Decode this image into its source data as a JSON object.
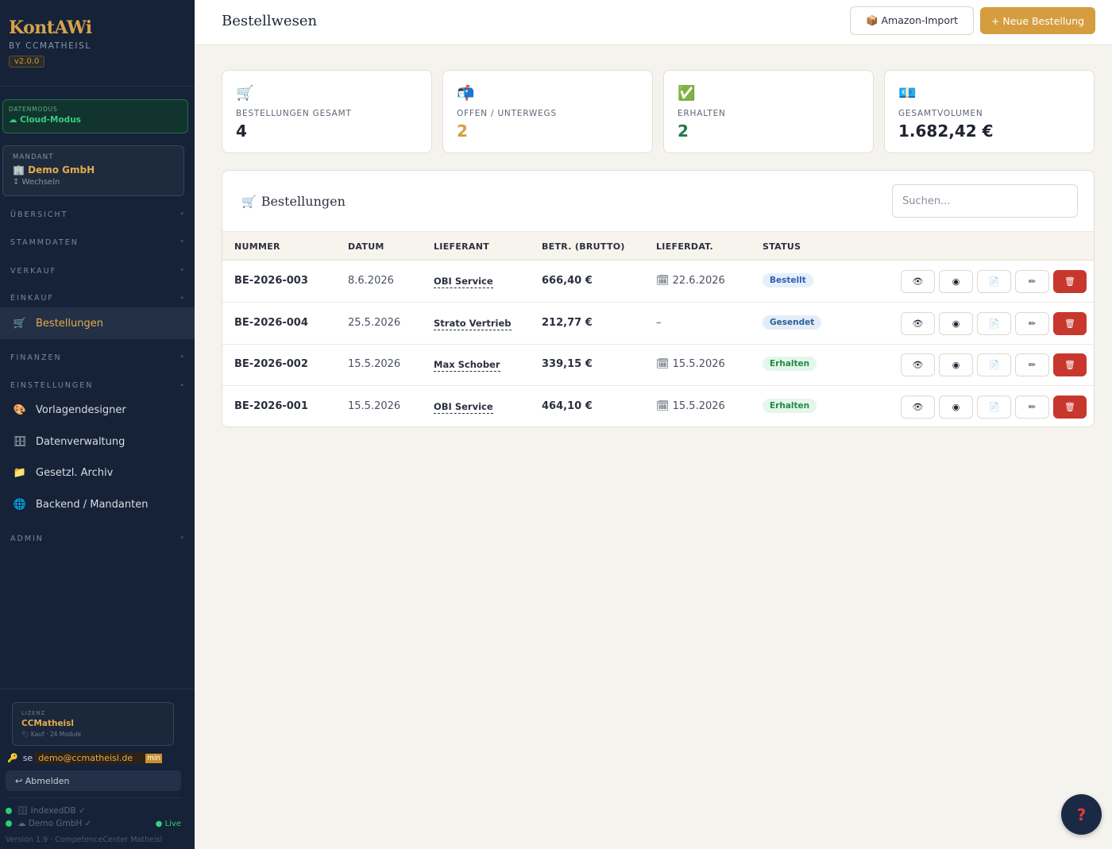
{
  "sidebar": {
    "brand": "KontAWi",
    "byline": "BY CCMATHEISL",
    "version_tag": "v2.0.0",
    "mode": {
      "label": "DATENMODUS",
      "icon": "cloud-icon",
      "value": "☁ Cloud-Modus"
    },
    "tenant": {
      "label": "MANDANT",
      "name": "🏢 Demo GmbH",
      "switch": "↕ Wechseln"
    },
    "sections": {
      "overview": "ÜBERSICHT",
      "masterdata": "STAMMDATEN",
      "sales": "VERKAUF",
      "purchasing": "EINKAUF",
      "finance": "FINANZEN",
      "settings": "EINSTELLUNGEN",
      "admin": "ADMIN"
    },
    "items": {
      "orders": {
        "icon": "🛒",
        "label": "Bestellungen"
      },
      "template": {
        "icon": "🎨",
        "label": "Vorlagendesigner"
      },
      "data": {
        "icon": "🗄",
        "label": "Datenverwaltung"
      },
      "archive": {
        "icon": "📁",
        "label": "Gesetzl. Archiv"
      },
      "backend": {
        "icon": "🌐",
        "label": "Backend / Mandanten"
      }
    },
    "license": {
      "label": "LIZENZ",
      "name": "CCMatheisl",
      "detail": "🏷 Kauf · 24 Module"
    },
    "user": {
      "prefix": "se",
      "email": "demo@ccmatheisl.de",
      "role": "min"
    },
    "logout": "↩ Abmelden",
    "status": {
      "db": "🗄 IndexedDB ✓",
      "tenant": "☁ Demo GmbH ✓",
      "live": "● Live"
    },
    "footer": "Version 1.9 · CompetenceCenter Matheisl"
  },
  "header": {
    "title": "Bestellwesen",
    "amazon_button": "📦 Amazon-Import",
    "new_button": "+ Neue Bestellung"
  },
  "stats": [
    {
      "icon": "🛒",
      "label": "BESTELLUNGEN GESAMT",
      "value": "4",
      "color": "#1f2430"
    },
    {
      "icon": "📬",
      "label": "OFFEN / UNTERWEGS",
      "value": "2",
      "color": "#d59d3e"
    },
    {
      "icon": "✅",
      "label": "ERHALTEN",
      "value": "2",
      "color": "#1f7a4a"
    },
    {
      "icon": "💶",
      "label": "GESAMTVOLUMEN",
      "value": "1.682,42 €",
      "color": "#1f2430"
    }
  ],
  "orders": {
    "title": "Bestellungen",
    "title_icon": "🛒",
    "search_placeholder": "Suchen...",
    "columns": [
      "NUMMER",
      "DATUM",
      "LIEFERANT",
      "BETR. (BRUTTO)",
      "LIEFERDAT.",
      "STATUS"
    ],
    "rows": [
      {
        "number": "BE-2026-003",
        "date": "8.6.2026",
        "supplier": "OBI Service",
        "amount": "666,40 €",
        "delivery": "🗓 22.6.2026",
        "status": "Bestellt",
        "status_kind": "bestellt"
      },
      {
        "number": "BE-2026-004",
        "date": "25.5.2026",
        "supplier": "Strato Vertrieb",
        "amount": "212,77 €",
        "delivery": "–",
        "status": "Gesendet",
        "status_kind": "gesendet"
      },
      {
        "number": "BE-2026-002",
        "date": "15.5.2026",
        "supplier": "Max Schober",
        "amount": "339,15 €",
        "delivery": "🗓 15.5.2026",
        "status": "Erhalten",
        "status_kind": "erhalten"
      },
      {
        "number": "BE-2026-001",
        "date": "15.5.2026",
        "supplier": "OBI Service",
        "amount": "464,10 €",
        "delivery": "🗓 15.5.2026",
        "status": "Erhalten",
        "status_kind": "erhalten"
      }
    ],
    "row_actions": [
      {
        "name": "view-icon",
        "glyph": "👁"
      },
      {
        "name": "send-icon",
        "glyph": "◉"
      },
      {
        "name": "document-icon",
        "glyph": "📄"
      },
      {
        "name": "edit-icon",
        "glyph": "✏"
      },
      {
        "name": "delete-icon",
        "glyph": "🗑"
      }
    ]
  },
  "help": {
    "glyph": "?"
  }
}
